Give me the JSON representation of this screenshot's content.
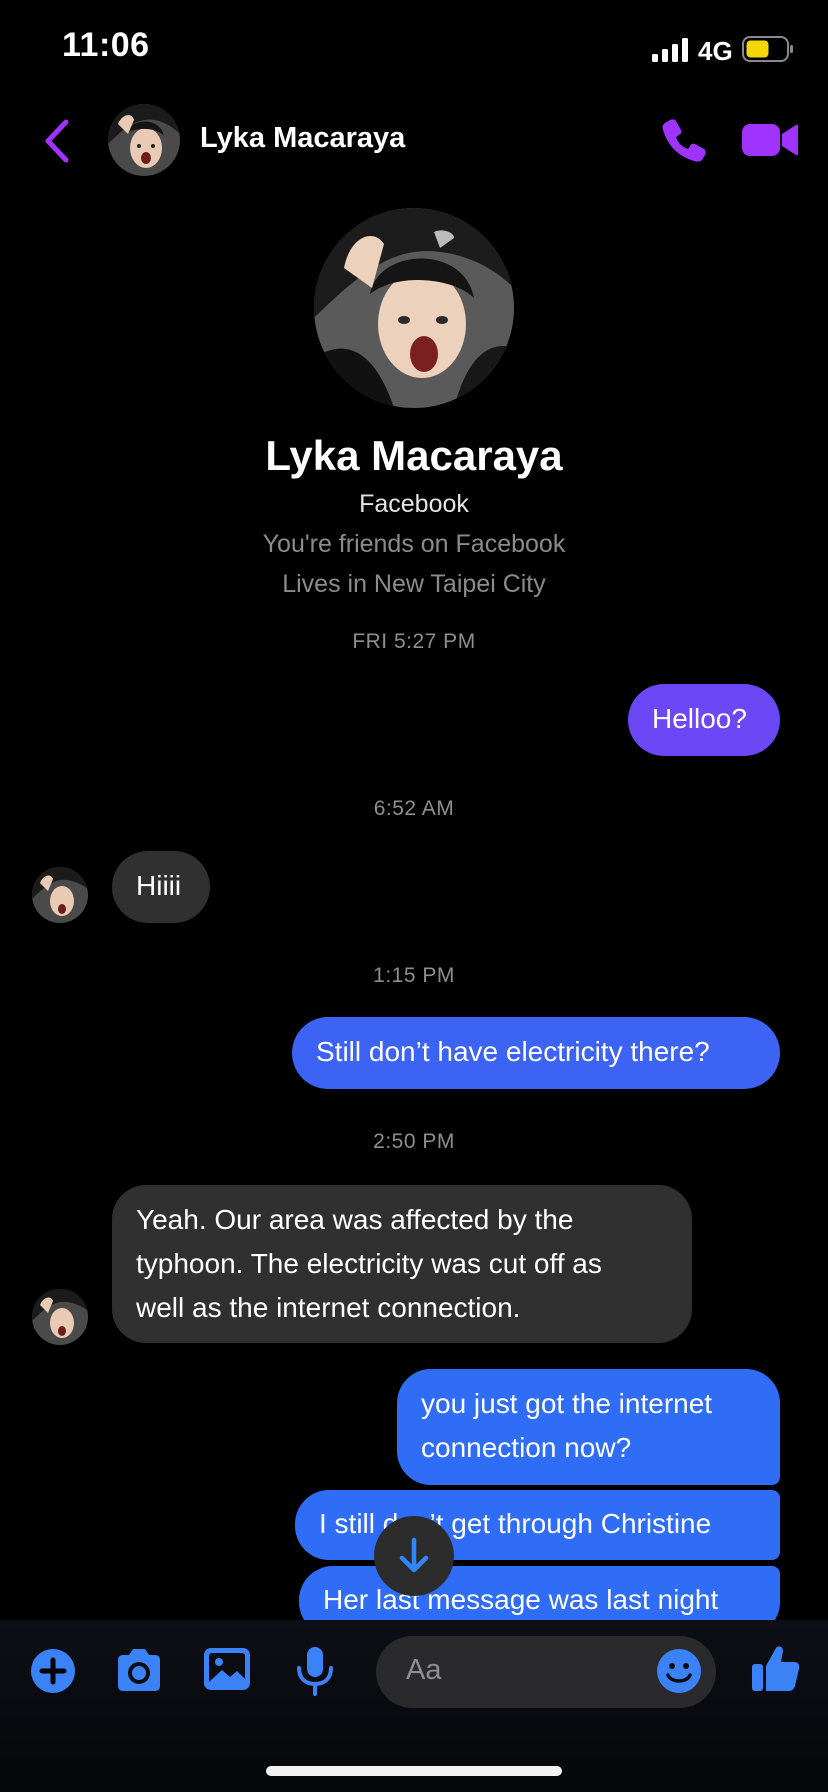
{
  "status_bar": {
    "time": "11:06",
    "network": "4G"
  },
  "header": {
    "contact_name": "Lyka Macaraya"
  },
  "profile": {
    "name": "Lyka Macaraya",
    "source": "Facebook",
    "friend_status": "You're friends on Facebook",
    "location": "Lives in New Taipei City"
  },
  "messages": {
    "ts1": "FRI 5:27 PM",
    "m1": "Helloo?",
    "ts2": "6:52 AM",
    "m2": "Hiiii",
    "ts3": "1:15 PM",
    "m3": "Still don’t have electricity there?",
    "ts4": "2:50 PM",
    "m4_l1": "Yeah. Our area was affected by the",
    "m4_l2": "typhoon. The electricity was cut off as",
    "m4_l3": "well as the internet connection.",
    "m5_l1": "you just got the internet",
    "m5_l2": "connection now?",
    "m6": "I still don’t get through Christine",
    "m7": "Her last message was last night"
  },
  "composer": {
    "placeholder": "Aa"
  },
  "colors": {
    "accent": "#a033ff",
    "blue": "#3b82f6",
    "bubble_violet": "#6b47f5",
    "bubble_blue": "#3d63f5",
    "bubble_incoming": "#303030",
    "battery": "#f5d60a"
  },
  "icons": [
    "signal-icon",
    "battery-icon",
    "back-chevron-icon",
    "phone-icon",
    "video-icon",
    "arrow-down-icon",
    "plus-icon",
    "camera-icon",
    "image-icon",
    "microphone-icon",
    "emoji-icon",
    "thumbs-up-icon"
  ]
}
